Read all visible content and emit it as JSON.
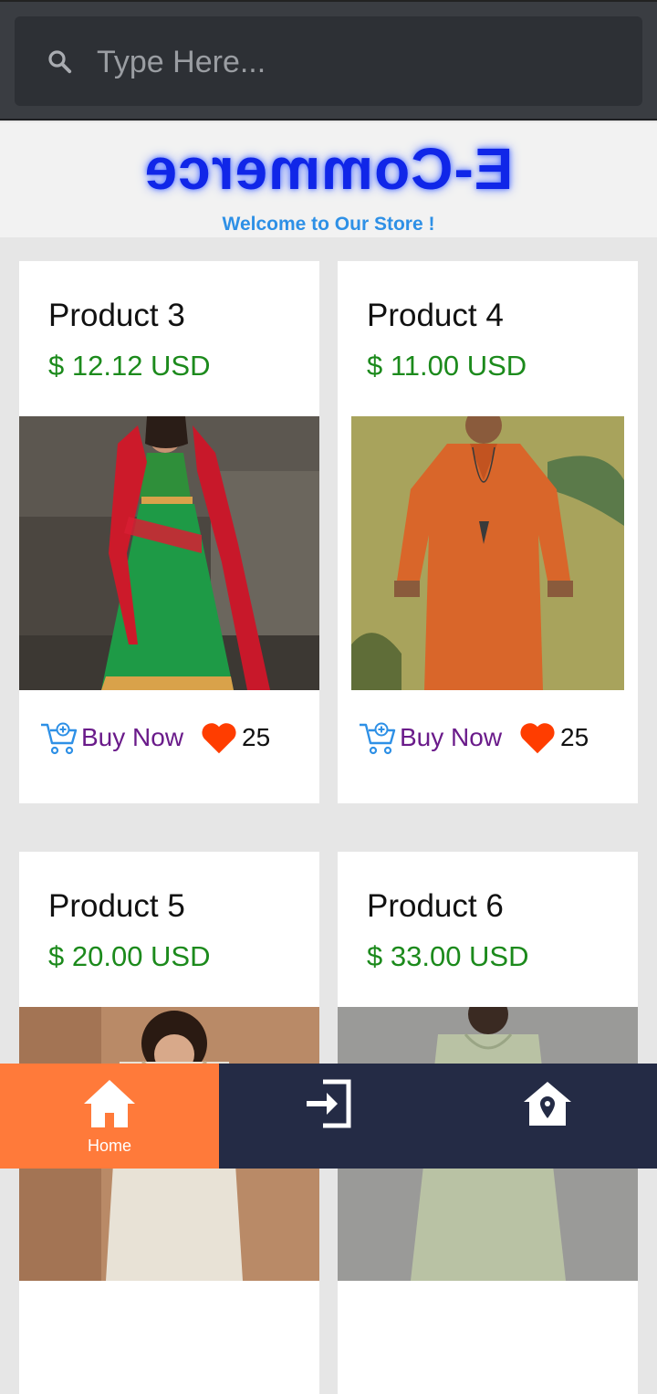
{
  "search": {
    "placeholder": "Type Here...",
    "icon": "search-icon"
  },
  "banner": {
    "brand": "E-Commerce",
    "tagline": "Welcome to Our Store !"
  },
  "colors": {
    "nav_bg": "#242b45",
    "nav_active": "#ff7a3a",
    "price": "#1c8a1c",
    "buy": "#6a1b8a",
    "heart": "#ff3d00"
  },
  "products": [
    {
      "title": "Product 3",
      "price": "$ 12.12 USD",
      "buy_label": "Buy Now",
      "likes": "25"
    },
    {
      "title": "Product 4",
      "price": "$ 11.00 USD",
      "buy_label": "Buy Now",
      "likes": "25"
    },
    {
      "title": "Product 5",
      "price": "$ 20.00 USD"
    },
    {
      "title": "Product 6",
      "price": "$ 33.00 USD"
    }
  ],
  "nav": {
    "items": [
      {
        "label": "Home",
        "icon": "home-icon",
        "active": true
      },
      {
        "label": "",
        "icon": "login-icon",
        "active": false
      },
      {
        "label": "",
        "icon": "location-pin-icon",
        "active": false
      }
    ]
  }
}
